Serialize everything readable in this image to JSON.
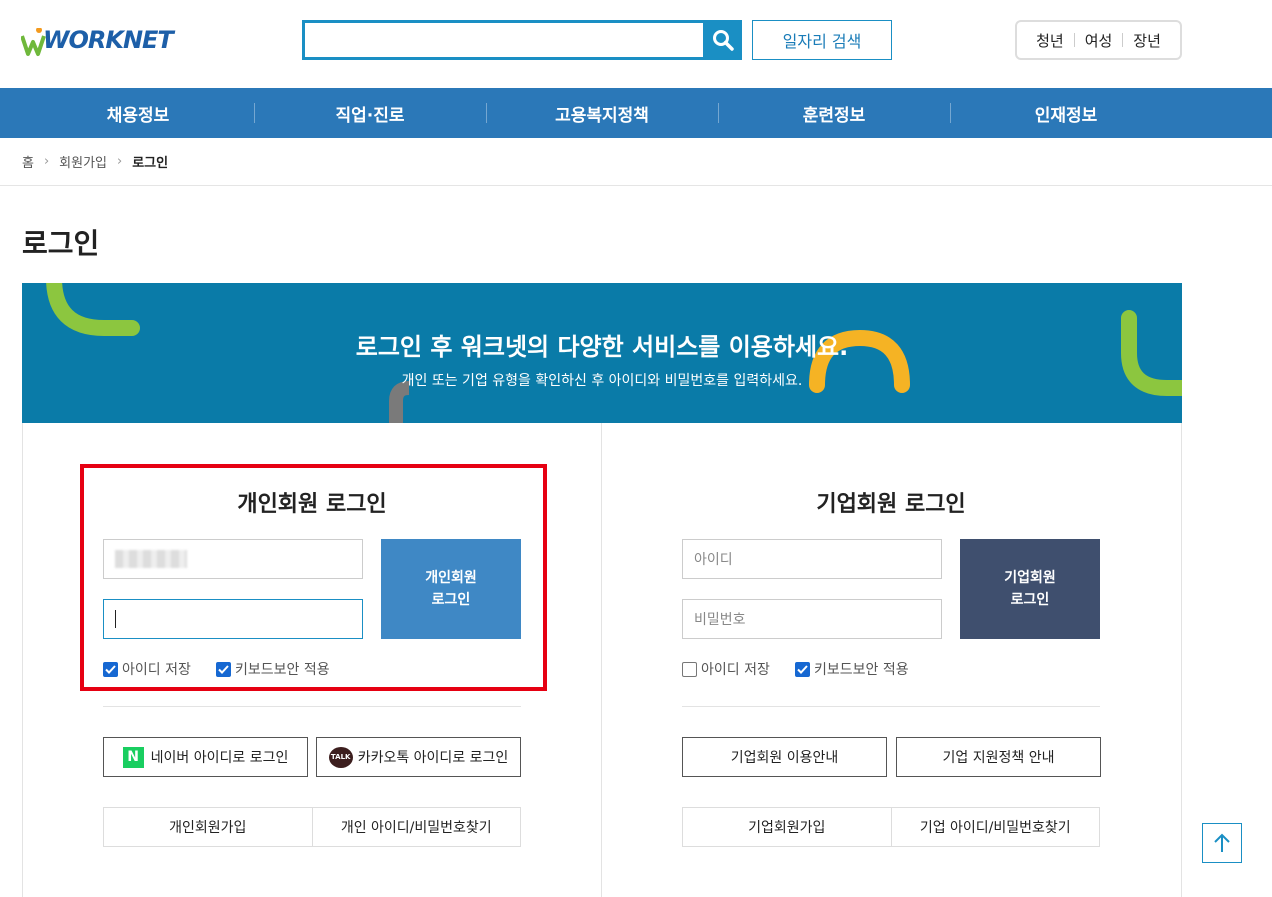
{
  "header": {
    "logo_text": "WORKNET",
    "search": {
      "value": "",
      "placeholder": ""
    },
    "job_search_label": "일자리 검색",
    "target_links": [
      "청년",
      "여성",
      "장년"
    ]
  },
  "nav": {
    "items": [
      "채용정보",
      "직업·진로",
      "고용복지정책",
      "훈련정보",
      "인재정보"
    ]
  },
  "breadcrumb": {
    "items": [
      "홈",
      "회원가입",
      "로그인"
    ]
  },
  "page_title": "로그인",
  "banner": {
    "title": "로그인 후 워크넷의 다양한 서비스를 이용하세요.",
    "subtitle": "개인 또는 기업 유형을 확인하신 후 아이디와 비밀번호를 입력하세요."
  },
  "personal": {
    "title": "개인회원 로그인",
    "id_value": "",
    "password_value": "",
    "login_button": [
      "개인회원",
      "로그인"
    ],
    "save_id_label": "아이디 저장",
    "save_id_checked": true,
    "keyboard_security_label": "키보드보안 적용",
    "keyboard_security_checked": true,
    "naver_button": "네이버 아이디로 로그인",
    "kakao_button": "카카오톡 아이디로 로그인",
    "signup_link": "개인회원가입",
    "find_link": "개인 아이디/비밀번호찾기"
  },
  "company": {
    "title": "기업회원 로그인",
    "id_placeholder": "아이디",
    "password_placeholder": "비밀번호",
    "login_button": [
      "기업회원",
      "로그인"
    ],
    "save_id_label": "아이디 저장",
    "save_id_checked": false,
    "keyboard_security_label": "키보드보안 적용",
    "keyboard_security_checked": true,
    "guide_button": "기업회원 이용안내",
    "policy_button": "기업 지원정책 안내",
    "signup_link": "기업회원가입",
    "find_link": "기업 아이디/비밀번호찾기"
  },
  "colors": {
    "brand_blue": "#2b78b8",
    "banner": "#0a7ba8",
    "personal_button": "#3f88c5",
    "company_button": "#3f4f6e",
    "highlight": "#e60012"
  }
}
